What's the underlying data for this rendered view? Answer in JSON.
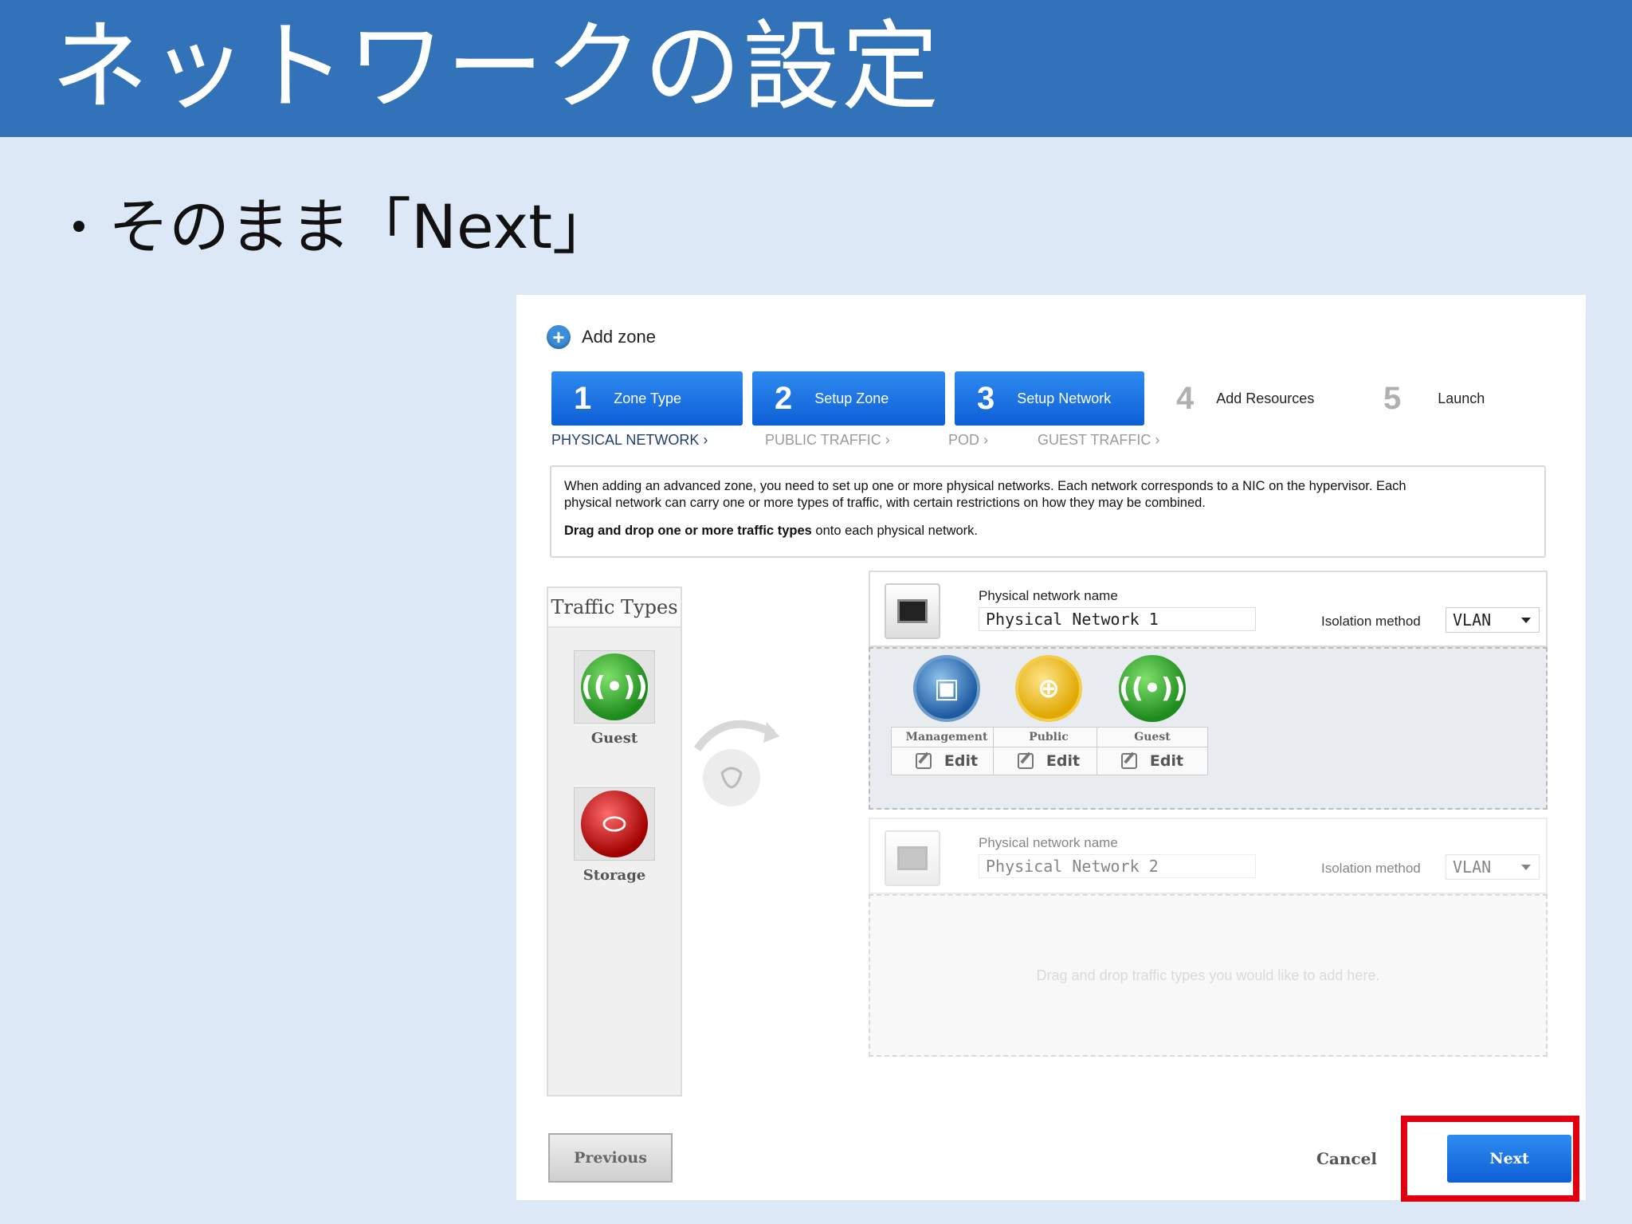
{
  "slide": {
    "title": "ネットワークの設定",
    "bullet": "そのまま「Next」"
  },
  "dialog": {
    "title": "Add zone",
    "steps": [
      {
        "num": "1",
        "label": "Zone Type",
        "active": true
      },
      {
        "num": "2",
        "label": "Setup Zone",
        "active": true
      },
      {
        "num": "3",
        "label": "Setup Network",
        "active": true
      },
      {
        "num": "4",
        "label": "Add Resources",
        "active": false
      },
      {
        "num": "5",
        "label": "Launch",
        "active": false
      }
    ],
    "subnav": [
      "PHYSICAL NETWORK ›",
      "PUBLIC TRAFFIC ›",
      "POD ›",
      "GUEST TRAFFIC ›"
    ],
    "info_line1": "When adding an advanced zone, you need to set up one or more physical networks. Each network corresponds to a NIC on the hypervisor. Each",
    "info_line2": "physical network can carry one or more types of traffic, with certain restrictions on how they may be combined.",
    "info_drag_bold": "Drag and drop one or more traffic types",
    "info_drag_rest": " onto each physical network.",
    "traffic_types_title": "Traffic Types",
    "traffic_types": [
      {
        "label": "Guest",
        "icon": "wireless-icon",
        "color": "#1c8a1c"
      },
      {
        "label": "Storage",
        "icon": "storage-icon",
        "color": "#a00000"
      }
    ],
    "physical_networks": [
      {
        "name_label": "Physical network name",
        "name": "Physical Network 1",
        "isolation_label": "Isolation method",
        "isolation": "VLAN",
        "traffic": [
          {
            "label": "Management",
            "edit": "Edit"
          },
          {
            "label": "Public",
            "edit": "Edit"
          },
          {
            "label": "Guest",
            "edit": "Edit"
          }
        ]
      },
      {
        "name_label": "Physical network name",
        "name": "Physical Network 2",
        "isolation_label": "Isolation method",
        "isolation": "VLAN",
        "drop_hint": "Drag and drop traffic types you would like to add here."
      }
    ],
    "buttons": {
      "previous": "Previous",
      "cancel": "Cancel",
      "next": "Next"
    }
  },
  "colors": {
    "title_bar": "#3272b8",
    "background": "#dce8f6",
    "accent": "#0d5fd6",
    "highlight": "#e0000f"
  }
}
